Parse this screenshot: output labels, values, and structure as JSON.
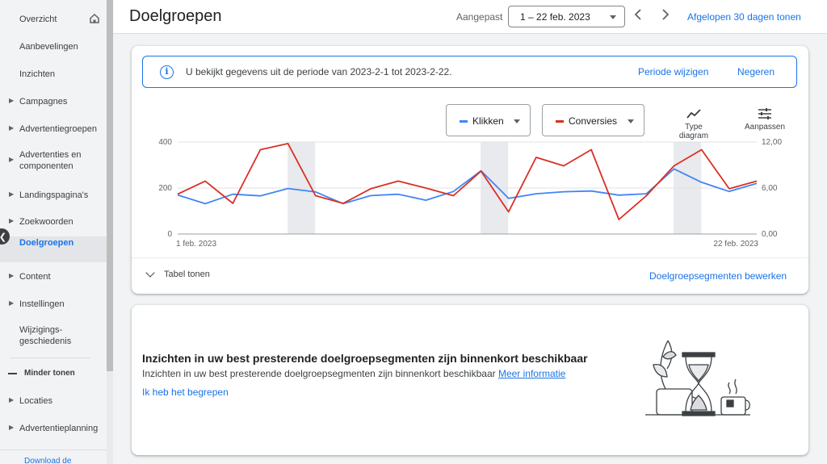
{
  "sidebar": {
    "items": [
      {
        "label": "Overzicht",
        "has_arrow": false
      },
      {
        "label": "Aanbevelingen",
        "has_arrow": false
      },
      {
        "label": "Inzichten",
        "has_arrow": false
      },
      {
        "label": "Campagnes",
        "has_arrow": true
      },
      {
        "label": "Advertentiegroepen",
        "has_arrow": true
      },
      {
        "label": "Advertenties en componenten",
        "has_arrow": true
      },
      {
        "label": "Landingspagina's",
        "has_arrow": true
      },
      {
        "label": "Zoekwoorden",
        "has_arrow": true
      },
      {
        "label": "Doelgroepen",
        "has_arrow": false,
        "active": true
      },
      {
        "label": "Content",
        "has_arrow": true
      },
      {
        "label": "Instellingen",
        "has_arrow": true
      },
      {
        "label": "Wijzigings-geschiedenis",
        "has_arrow": false
      }
    ],
    "show_less": "Minder tonen",
    "extra_items": [
      {
        "label": "Locaties",
        "has_arrow": true
      },
      {
        "label": "Advertentieplanning",
        "has_arrow": true
      }
    ],
    "download_link": "Download de"
  },
  "header": {
    "title": "Doelgroepen",
    "date_mode": "Aangepast",
    "date_range": "1 – 22 feb. 2023",
    "last_30_days": "Afgelopen 30 dagen tonen"
  },
  "banner": {
    "text": "U bekijkt gegevens uit de periode van 2023-2-1 tot 2023-2-22.",
    "change_period": "Periode wijzigen",
    "ignore": "Negeren"
  },
  "controls": {
    "metric1": "Klikken",
    "metric2": "Conversies",
    "chart_type": "Type diagram",
    "customize": "Aanpassen"
  },
  "chart_data": {
    "type": "line",
    "x_start_label": "1 feb. 2023",
    "x_end_label": "22 feb. 2023",
    "left_ticks": [
      "400",
      "200",
      "0"
    ],
    "right_ticks": [
      "12,00",
      "6,00",
      "0,00"
    ],
    "ylim_left": [
      0,
      400
    ],
    "ylim_right": [
      0,
      12
    ],
    "grid": true,
    "weekend_bands": [
      [
        4,
        5
      ],
      [
        11,
        12
      ],
      [
        18,
        19
      ]
    ],
    "series": [
      {
        "name": "Klikken",
        "axis": "left",
        "color": "#4285f4",
        "values": [
          170,
          132,
          173,
          166,
          198,
          183,
          132,
          167,
          173,
          147,
          185,
          275,
          155,
          175,
          184,
          187,
          169,
          175,
          283,
          225,
          185,
          220
        ]
      },
      {
        "name": "Conversies",
        "axis": "right",
        "color": "#d93025",
        "values": [
          5.2,
          6.9,
          4.0,
          11.0,
          11.8,
          5.0,
          4.0,
          5.9,
          6.9,
          6.0,
          5.0,
          8.2,
          2.9,
          10.0,
          8.9,
          11.0,
          1.9,
          5.0,
          8.9,
          11.0,
          5.9,
          6.9
        ]
      }
    ]
  },
  "chart_footer": {
    "table_toggle": "Tabel tonen",
    "edit_segments": "Doelgroepsegmenten bewerken"
  },
  "insight": {
    "heading": "Inzichten in uw best presterende doelgroepsegmenten zijn binnenkort beschikbaar",
    "body": "Inzichten in uw best presterende doelgroepsegmenten zijn binnenkort beschikbaar",
    "more_link": "Meer informatie",
    "ack": "Ik heb het begrepen"
  },
  "colors": {
    "accent": "#1a73e8",
    "klikken": "#4285f4",
    "conversies": "#d93025"
  }
}
